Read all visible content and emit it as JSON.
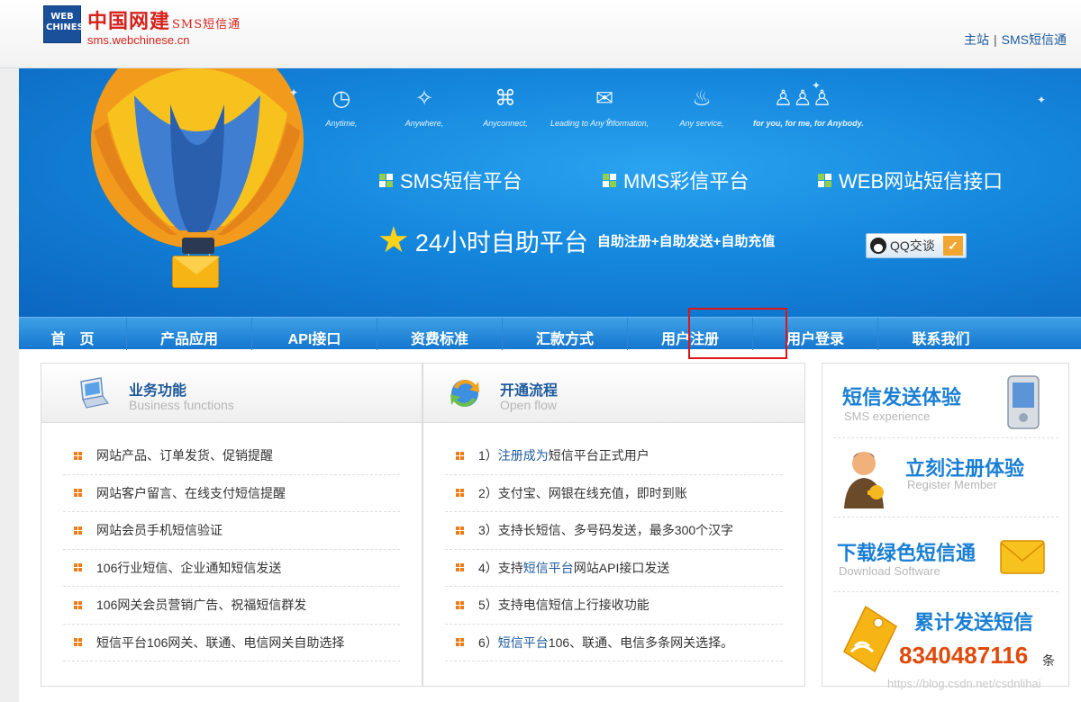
{
  "header": {
    "logo_box": "WEB CHINESE",
    "logo_cn": "中国网建",
    "logo_cn_suffix": "SMS短信通",
    "logo_url": "sms.webchinese.cn",
    "links": [
      "主站",
      "SMS短信通"
    ],
    "link_separator": "|"
  },
  "banner": {
    "features": [
      {
        "icon": "clock-icon",
        "glyph": "◷",
        "label": "Anytime,"
      },
      {
        "icon": "compass-icon",
        "glyph": "✧",
        "label": "Anywhere,"
      },
      {
        "icon": "connect-icon",
        "glyph": "⌘",
        "label": "Anyconnect,"
      },
      {
        "icon": "mail-icon",
        "glyph": "✉",
        "label": "Leading to Any information,"
      },
      {
        "icon": "service-icon",
        "glyph": "♨",
        "label": "Any service,"
      },
      {
        "icon": "people-icon",
        "glyph": "♙♙♙",
        "label": "for you, for me, for Anybody."
      }
    ],
    "services": [
      "SMS短信平台",
      "MMS彩信平台",
      "WEB网站短信接口"
    ],
    "slogan_main": "24小时自助平台",
    "slogan_sub": "自助注册+自助发送+自助充值",
    "qq_label": "QQ交谈"
  },
  "nav": {
    "items": [
      "首　页",
      "产品应用",
      "API接口",
      "资费标准",
      "汇款方式",
      "用户注册",
      "用户登录",
      "联系我们"
    ]
  },
  "panels": {
    "business": {
      "title": "业务功能",
      "subtitle": "Business functions",
      "items": [
        "网站产品、订单发货、促销提醒",
        "网站客户留言、在线支付短信提醒",
        "网站会员手机短信验证",
        "106行业短信、企业通知短信发送",
        "106网关会员营销广告、祝福短信群发",
        "短信平台106网关、联通、电信网关自助选择"
      ]
    },
    "process": {
      "title": "开通流程",
      "subtitle": "Open flow",
      "items": [
        {
          "num": "1）",
          "link": "注册成为",
          "rest": "短信平台正式用户"
        },
        {
          "num": "2）",
          "link": "",
          "rest": "支付宝、网银在线充值，即时到账"
        },
        {
          "num": "3）",
          "link": "",
          "rest": "支持长短信、多号码发送，最多300个汉字"
        },
        {
          "num": "4）",
          "pre": "支持",
          "link": "短信平台",
          "rest": "网站API接口发送"
        },
        {
          "num": "5）",
          "link": "",
          "rest": "支持电信短信上行接收功能"
        },
        {
          "num": "6）",
          "link": "短信平台",
          "rest": "106、联通、电信多条网关选择。"
        }
      ]
    }
  },
  "sidebar": {
    "blocks": [
      {
        "title": "短信发送体验",
        "subtitle": "SMS experience"
      },
      {
        "title": "立刻注册体验",
        "subtitle": "Register Member"
      },
      {
        "title": "下载绿色短信通",
        "subtitle": "Download Software"
      },
      {
        "title": "累计发送短信",
        "subtitle": ""
      }
    ],
    "counter": "8340487116",
    "counter_unit": "条"
  },
  "watermark": "https://blog.csdn.net/csdnlihai",
  "colors": {
    "brand_red": "#d4231b",
    "nav_blue": "#1476cf",
    "link_blue": "#1e5a9c",
    "bullet_orange": "#f07c17",
    "counter_orange": "#e04a0c",
    "highlight_red": "#e01414"
  }
}
